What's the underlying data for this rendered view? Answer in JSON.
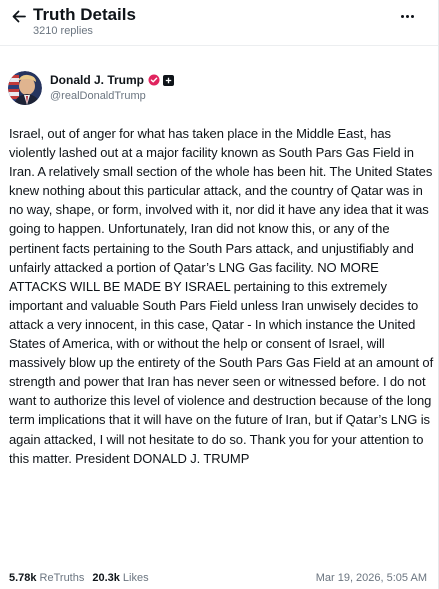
{
  "header": {
    "title": "Truth Details",
    "replies": "3210 replies",
    "back_icon": "arrow-left-icon",
    "more_icon": "more-horizontal-icon"
  },
  "author": {
    "name": "Donald J. Trump",
    "handle": "@realDonaldTrump",
    "verified_color": "#e0245e",
    "badge_icon": "plus-square-icon"
  },
  "post": {
    "text": "Israel, out of anger for what has taken place in the Middle East, has violently lashed out at a major facility known as South Pars Gas Field in Iran. A relatively small section of the whole has been hit. The United States knew nothing about this particular attack, and the country of Qatar was in no way, shape, or form, involved with it, nor did it have any idea that it was going to happen. Unfortunately, Iran did not know this, or any of the pertinent facts pertaining to the South Pars attack, and unjustifiably and unfairly attacked a portion of Qatar’s LNG Gas facility. NO MORE ATTACKS WILL BE MADE BY ISRAEL pertaining to this extremely important and valuable South Pars Field unless Iran unwisely decides to attack a very innocent, in this case, Qatar - In which instance the United States of America, with or without the help or consent of Israel, will massively blow up the entirety of the South Pars Gas Field at an amount of strength and power that Iran has never seen or witnessed before. I do not want to authorize this level of violence and destruction because of the long term implications that it will have on the future of Iran, but if Qatar’s LNG is again attacked, I will not hesitate to do so. Thank you for your attention to this matter. President DONALD J. TRUMP"
  },
  "stats": {
    "retruths_count": "5.78k",
    "retruths_label": "ReTruths",
    "likes_count": "20.3k",
    "likes_label": "Likes"
  },
  "timestamp": "Mar 19, 2026, 5:05 AM"
}
